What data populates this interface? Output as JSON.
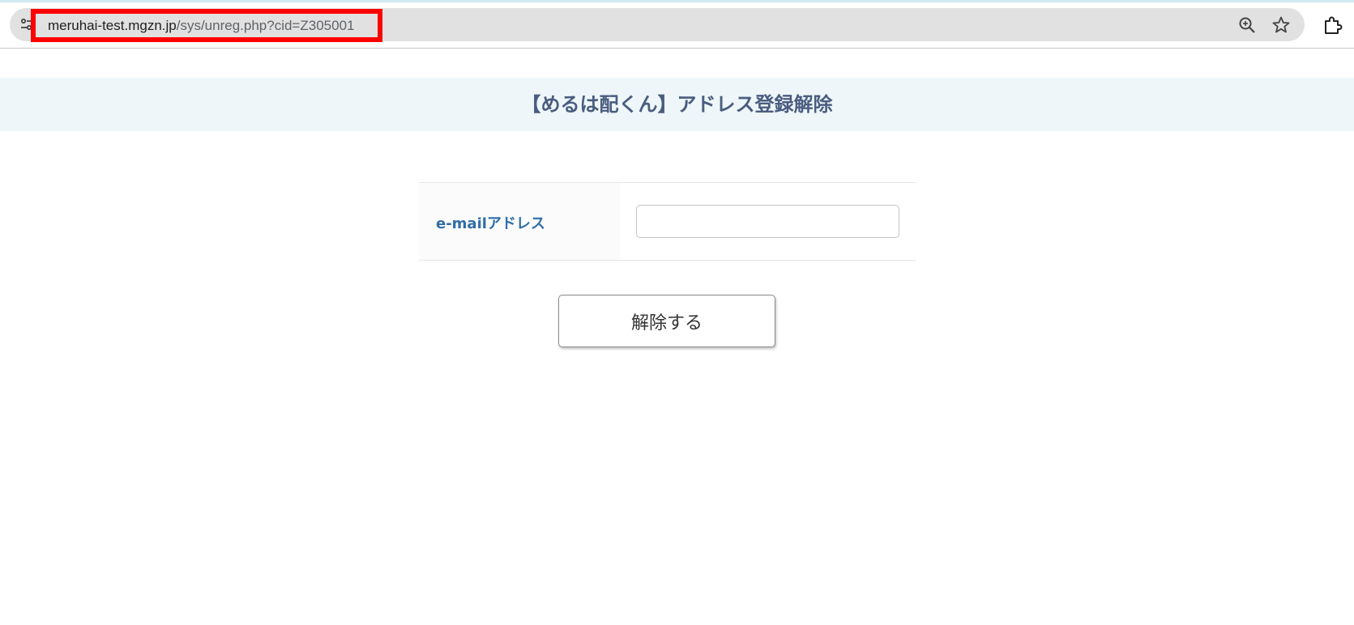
{
  "browser": {
    "url_host": "meruhai-test.mgzn.jp",
    "url_path": "/sys/unreg.php?cid=Z305001",
    "icons": {
      "site_info": "tune-icon",
      "zoom": "zoom-in-icon",
      "bookmark": "star-icon",
      "extensions": "puzzle-icon"
    },
    "highlight_color": "#ff0000"
  },
  "page": {
    "title": "【めるは配くん】アドレス登録解除",
    "form": {
      "email_label": "e-mailアドレス",
      "email_value": "",
      "email_placeholder": ""
    },
    "submit_label": "解除する"
  },
  "colors": {
    "title": "#4a5d80",
    "label": "#2f6ea8",
    "header_band": "#eef6f9"
  }
}
